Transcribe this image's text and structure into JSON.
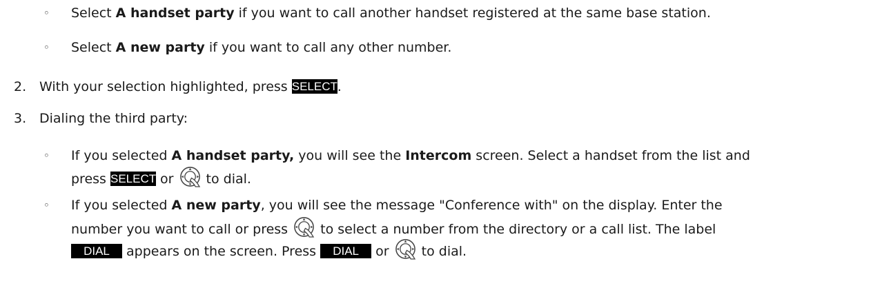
{
  "bullet_a": {
    "pre": "Select ",
    "bold": "A handset party",
    "post": " if you want to call another handset registered at the same base station."
  },
  "bullet_b": {
    "pre": "Select ",
    "bold": "A new party",
    "post": " if you want to call any other number."
  },
  "step2": {
    "num": "2.",
    "pre": "With your selection highlighted, press ",
    "key": "SELECT",
    "post": "."
  },
  "step3": {
    "num": "3.",
    "text": "Dialing the third party:"
  },
  "bullet_c": {
    "line1_pre": "If you selected ",
    "line1_bold": "A handset party,",
    "line1_mid": " you will see the ",
    "line1_bold2": "Intercom",
    "line1_post": " screen.  Select a handset from the list and",
    "line2_pre": "press ",
    "line2_key": "SELECT",
    "line2_or": " or ",
    "line2_post": " to dial."
  },
  "bullet_d": {
    "line1_pre": "If you selected ",
    "line1_bold": "A new party",
    "line1_post": ", you will see the message \"Conference with\" on the display.  Enter the",
    "line2_pre": "number you want to call or press ",
    "line2_post": " to select a number from the directory or a call list.  The label",
    "line3_key": "DIAL",
    "line3_mid": " appears on the screen.  Press ",
    "line3_key2": "DIAL",
    "line3_or": " or ",
    "line3_post": " to dial."
  },
  "bullet_glyph": "◦",
  "icons": {
    "nav_key": "navigation-key-icon"
  }
}
